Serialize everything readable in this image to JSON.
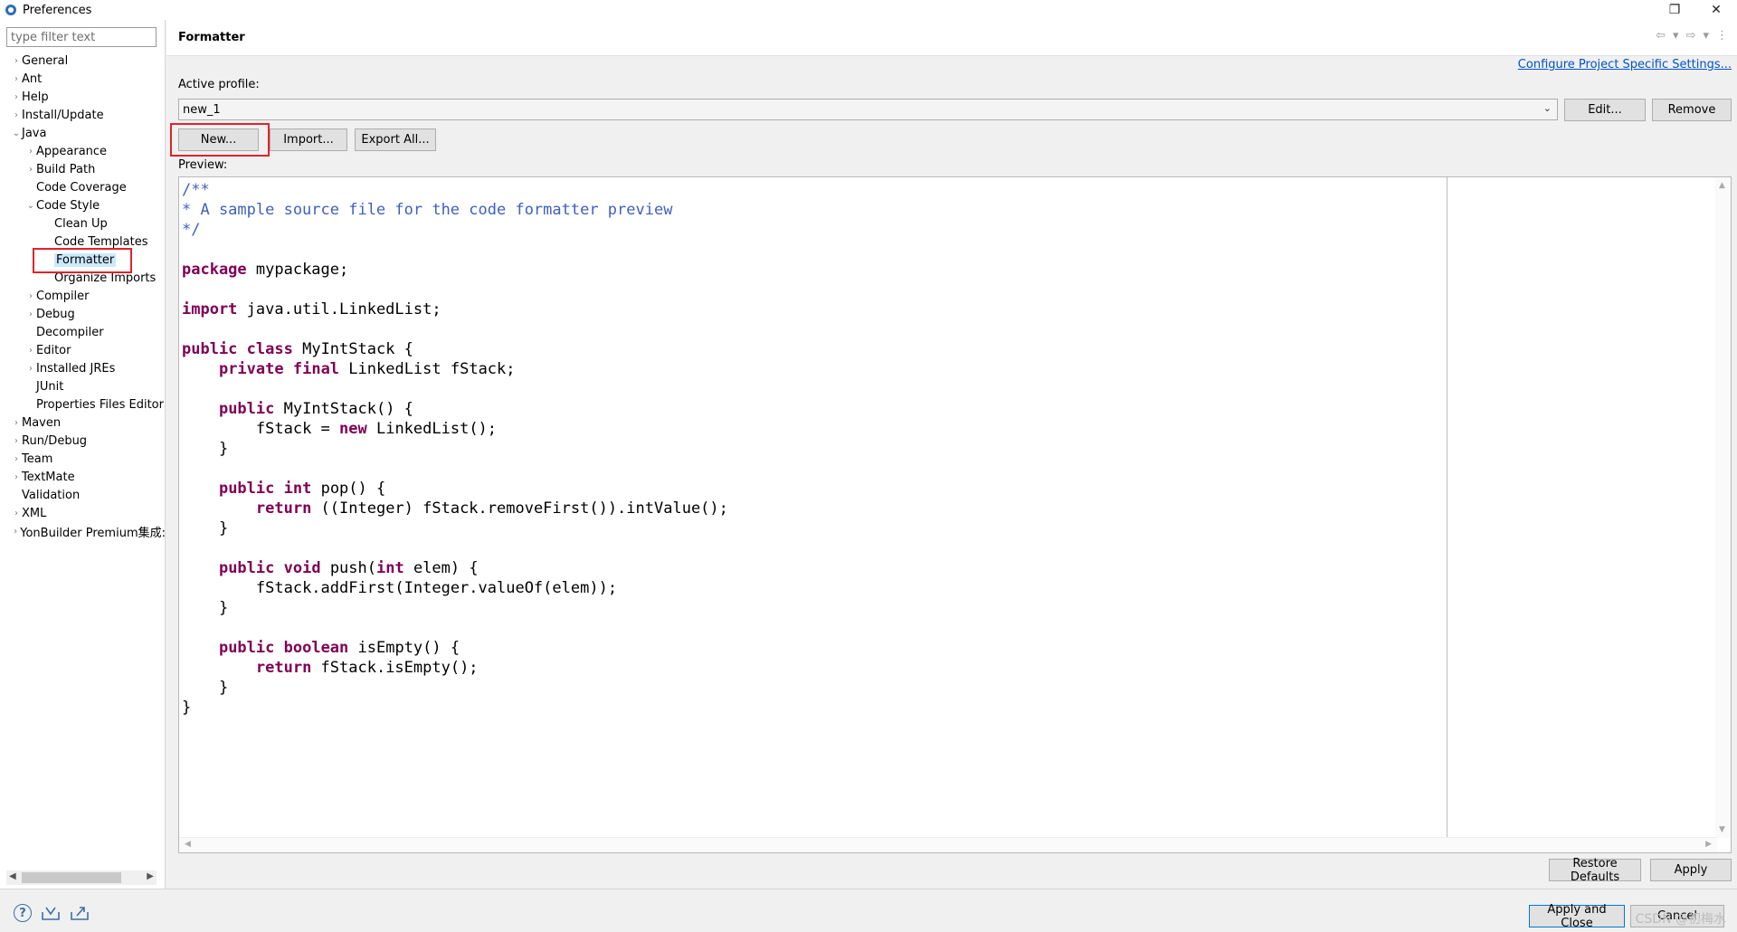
{
  "window": {
    "title": "Preferences"
  },
  "window_controls": {
    "restore": "❐",
    "close": "✕"
  },
  "sidebar": {
    "filter_placeholder": "type filter text",
    "items": [
      {
        "label": "General",
        "arrow": "›"
      },
      {
        "label": "Ant",
        "arrow": "›"
      },
      {
        "label": "Help",
        "arrow": "›"
      },
      {
        "label": "Install/Update",
        "arrow": "›"
      },
      {
        "label": "Java",
        "arrow": "⌄"
      },
      {
        "label": "Appearance",
        "arrow": "›"
      },
      {
        "label": "Build Path",
        "arrow": "›"
      },
      {
        "label": "Code Coverage",
        "arrow": ""
      },
      {
        "label": "Code Style",
        "arrow": "⌄"
      },
      {
        "label": "Clean Up",
        "arrow": ""
      },
      {
        "label": "Code Templates",
        "arrow": ""
      },
      {
        "label": "Formatter",
        "arrow": ""
      },
      {
        "label": "Organize Imports",
        "arrow": ""
      },
      {
        "label": "Compiler",
        "arrow": "›"
      },
      {
        "label": "Debug",
        "arrow": "›"
      },
      {
        "label": "Decompiler",
        "arrow": ""
      },
      {
        "label": "Editor",
        "arrow": "›"
      },
      {
        "label": "Installed JREs",
        "arrow": "›"
      },
      {
        "label": "JUnit",
        "arrow": ""
      },
      {
        "label": "Properties Files Editor",
        "arrow": ""
      },
      {
        "label": "Maven",
        "arrow": "›"
      },
      {
        "label": "Run/Debug",
        "arrow": "›"
      },
      {
        "label": "Team",
        "arrow": "›"
      },
      {
        "label": "TextMate",
        "arrow": "›"
      },
      {
        "label": "Validation",
        "arrow": ""
      },
      {
        "label": "XML",
        "arrow": "›"
      },
      {
        "label": "YonBuilder Premium集成:",
        "arrow": "›"
      }
    ],
    "selected": "Formatter"
  },
  "page": {
    "title": "Formatter",
    "config_link": "Configure Project Specific Settings...",
    "active_profile_label": "Active profile:",
    "profile_value": "new_1",
    "buttons": {
      "edit": "Edit...",
      "remove": "Remove",
      "new": "New...",
      "import": "Import...",
      "export_all": "Export All..."
    },
    "preview_label": "Preview:"
  },
  "code_preview": {
    "c1": "/**",
    "c2": "* A sample source file for the code formatter preview",
    "c3": "*/",
    "kw_package": "package",
    "package_name": " mypackage;",
    "kw_import": "import",
    "import_name": " java.util.LinkedList;",
    "kw_public": "public",
    "kw_class": "class",
    "class_rest": " MyIntStack {",
    "kw_private": "private",
    "kw_final": "final",
    "field_rest": " LinkedList fStack;",
    "ctor_rest": " MyIntStack() {",
    "assign_lhs": "fStack = ",
    "kw_new": "new",
    "assign_rhs": " LinkedList();",
    "close_brace": "}",
    "kw_int": "int",
    "pop_rest": " pop() {",
    "kw_return": "return",
    "pop_body": " ((Integer) fStack.removeFirst()).intValue();",
    "kw_void": "void",
    "push_name": " push(",
    "push_param": " elem) {",
    "push_body": "fStack.addFirst(Integer.valueOf(elem));",
    "kw_boolean": "boolean",
    "isempty_rest": " isEmpty() {",
    "isempty_body": " fStack.isEmpty();"
  },
  "footer": {
    "restore_defaults": "Restore Defaults",
    "apply": "Apply",
    "apply_and_close": "Apply and Close",
    "cancel": "Cancel",
    "watermark": "CSDN @初梅水"
  },
  "colors": {
    "keyword": "#7f0055",
    "comment": "#3f5fbf",
    "link": "#0052cc",
    "highlight": "#e0232b",
    "selection": "#cce8ff"
  }
}
